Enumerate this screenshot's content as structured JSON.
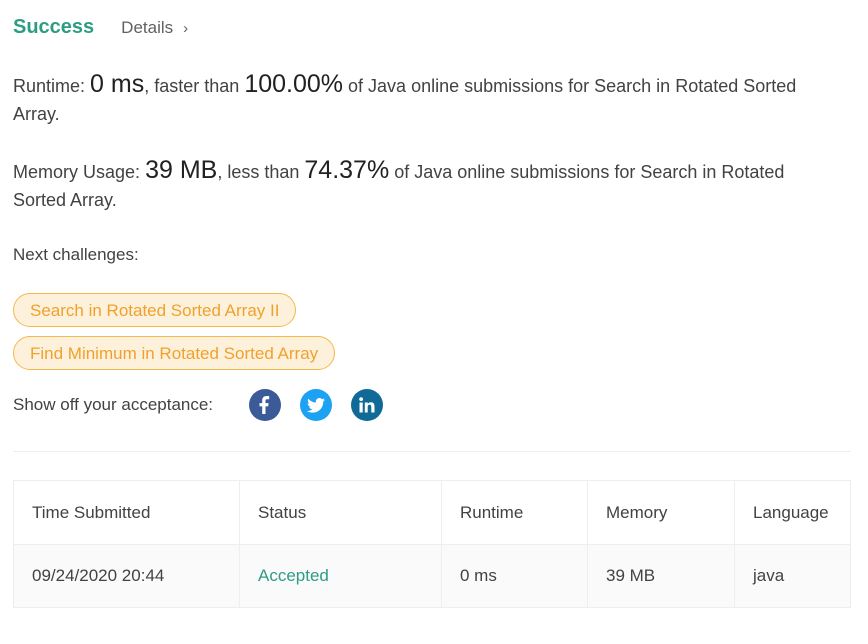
{
  "header": {
    "status": "Success",
    "details_label": "Details",
    "details_chevron": "›"
  },
  "runtime_stat": {
    "label": "Runtime:",
    "value": "0 ms",
    "comparator": ", faster than",
    "percent": "100.00%",
    "suffix": "of Java online submissions for Search in Rotated Sorted Array."
  },
  "memory_stat": {
    "label": "Memory Usage:",
    "value": "39 MB",
    "comparator": ", less than",
    "percent": "74.37%",
    "suffix": "of Java online submissions for Search in Rotated Sorted Array."
  },
  "next_challenges": {
    "label": "Next challenges:",
    "items": [
      "Search in Rotated Sorted Array II",
      "Find Minimum in Rotated Sorted Array"
    ]
  },
  "share": {
    "label": "Show off your acceptance:",
    "icons": [
      "facebook-icon",
      "twitter-icon",
      "linkedin-icon"
    ],
    "colors": {
      "facebook": "#3a5a98",
      "twitter": "#1da1f2",
      "linkedin": "#0f6a97"
    }
  },
  "submissions": {
    "headers": [
      "Time Submitted",
      "Status",
      "Runtime",
      "Memory",
      "Language"
    ],
    "rows": [
      {
        "time": "09/24/2020 20:44",
        "status": "Accepted",
        "runtime": "0 ms",
        "memory": "39 MB",
        "language": "java"
      }
    ]
  },
  "colors": {
    "success": "#2e9c83",
    "pill_text": "#f0a12c",
    "pill_border": "#f5b94a",
    "pill_bg": "#fdf1dc"
  }
}
